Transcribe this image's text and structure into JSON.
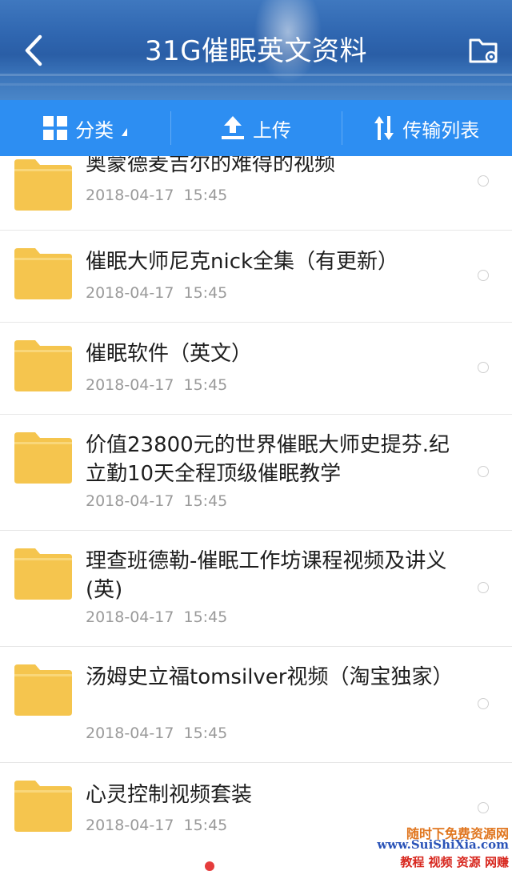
{
  "header": {
    "title": "31G催眠英文资料",
    "back_icon": "chevron-left-icon",
    "folder_settings_icon": "folder-settings-icon"
  },
  "toolbar": {
    "category_label": "分类",
    "upload_label": "上传",
    "transfer_label": "传输列表"
  },
  "files": [
    {
      "name": "奥蒙德麦吉尔的难得的视频",
      "date": "2018-04-17  15:45"
    },
    {
      "name": "催眠大师尼克nick全集（有更新）",
      "date": "2018-04-17  15:45"
    },
    {
      "name": "催眠软件（英文）",
      "date": "2018-04-17  15:45"
    },
    {
      "name": "价值23800元的世界催眠大师史提芬.纪立勤10天全程顶级催眠教学",
      "date": "2018-04-17  15:45"
    },
    {
      "name": "理查班德勒-催眠工作坊课程视频及讲义(英)",
      "date": "2018-04-17  15:45"
    },
    {
      "name": "汤姆史立福tomsilver视频（淘宝独家）",
      "date": "2018-04-17  15:45"
    },
    {
      "name": "心灵控制视频套装",
      "date": "2018-04-17  15:45"
    }
  ],
  "watermark": {
    "line1": "随时下免费资源网",
    "line2": "www.SuiShiXia.com",
    "line3": "教程 视频 资源 网赚"
  },
  "colors": {
    "toolbar": "#2d8ef2",
    "folder": "#f5c54e",
    "header": "#2f66b0"
  }
}
